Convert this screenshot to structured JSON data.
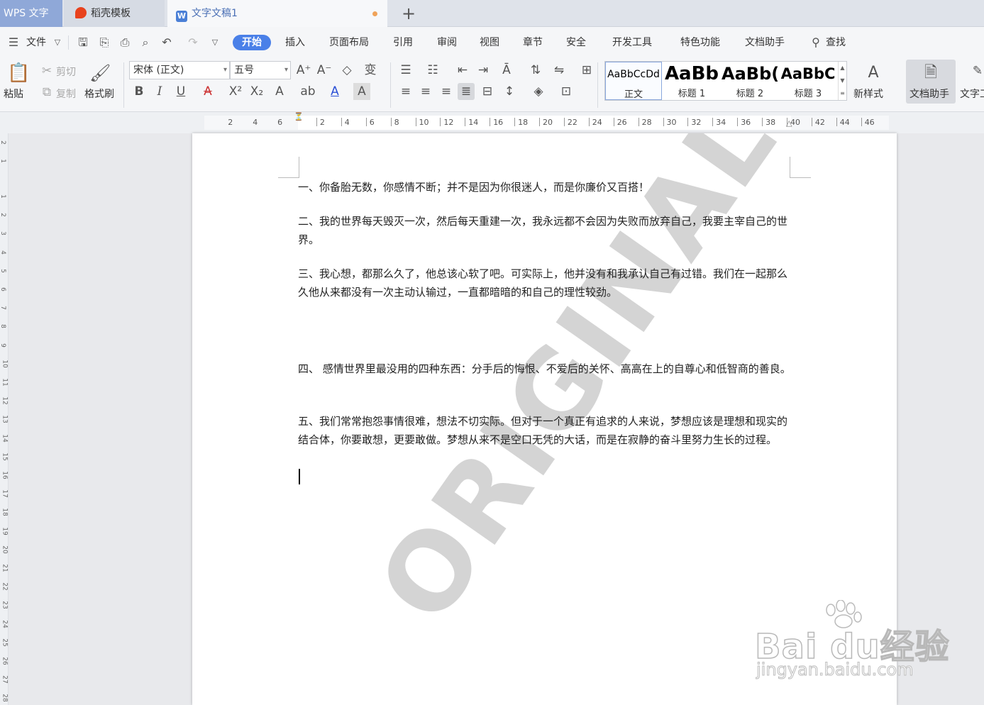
{
  "titlebar": {
    "app_name": "WPS 文字",
    "tabs": [
      {
        "label": "稻壳模板"
      },
      {
        "label": "文字文稿1"
      }
    ],
    "new_tab": "+"
  },
  "menu": {
    "file": "文件",
    "items": [
      "开始",
      "插入",
      "页面布局",
      "引用",
      "审阅",
      "视图",
      "章节",
      "安全",
      "开发工具",
      "特色功能",
      "文档助手"
    ],
    "active": "开始",
    "search": "查找"
  },
  "ribbon": {
    "paste": "粘贴",
    "cut": "剪切",
    "copy": "复制",
    "format_painter": "格式刷",
    "font_name": "宋体 (正文)",
    "font_size": "五号",
    "bold": "B",
    "italic": "I",
    "underline": "U",
    "styles": [
      {
        "sample": "AaBbCcDd",
        "name": "正文"
      },
      {
        "sample": "AaBb",
        "name": "标题 1"
      },
      {
        "sample": "AaBb(",
        "name": "标题 2"
      },
      {
        "sample": "AaBbC",
        "name": "标题 3"
      }
    ],
    "new_style": "新样式",
    "doc_assistant": "文档助手",
    "text_tools": "文字工"
  },
  "ruler": {
    "left_numbers": [
      "6",
      "4",
      "2"
    ],
    "right_numbers": [
      "2",
      "4",
      "6",
      "8",
      "10",
      "12",
      "14",
      "16",
      "18",
      "20",
      "22",
      "24",
      "26",
      "28",
      "30",
      "32",
      "34",
      "36",
      "38",
      "40",
      "42",
      "44",
      "46"
    ],
    "vertical_numbers": [
      "2",
      "1",
      "1",
      "2",
      "3",
      "4",
      "5",
      "6",
      "7",
      "8",
      "9",
      "10",
      "11",
      "12",
      "13",
      "14",
      "15",
      "16",
      "17",
      "18",
      "19",
      "20",
      "21",
      "22",
      "23",
      "24",
      "25",
      "26",
      "27",
      "28"
    ]
  },
  "document": {
    "paragraphs": [
      "一、你备胎无数，你感情不断；并不是因为你很迷人，而是你廉价又百搭！",
      "二、我的世界每天毁灭一次，然后每天重建一次，我永远都不会因为失败而放弃自己，我要主宰自己的世界。",
      "三、我心想，都那么久了，他总该心软了吧。可实际上，他并没有和我承认自己有过错。我们在一起那么久他从来都没有一次主动认输过，一直都暗暗的和自己的理性较劲。",
      "四、 感情世界里最没用的四种东西：分手后的悔恨、不爱后的关怀、高高在上的自尊心和低智商的善良。",
      "五、我们常常抱怨事情很难，想法不切实际。但对于一个真正有追求的人来说，梦想应该是理想和现实的结合体，你要敢想，更要敢做。梦想从来不是空口无凭的大话，而是在寂静的奋斗里努力生长的过程。"
    ],
    "watermark": "ORIGINAL"
  },
  "overlay": {
    "brand": "Bai du经验",
    "url": "jingyan.baidu.com"
  },
  "colors": {
    "accent": "#4a80e8",
    "app_tab": "#8fa8d8"
  }
}
